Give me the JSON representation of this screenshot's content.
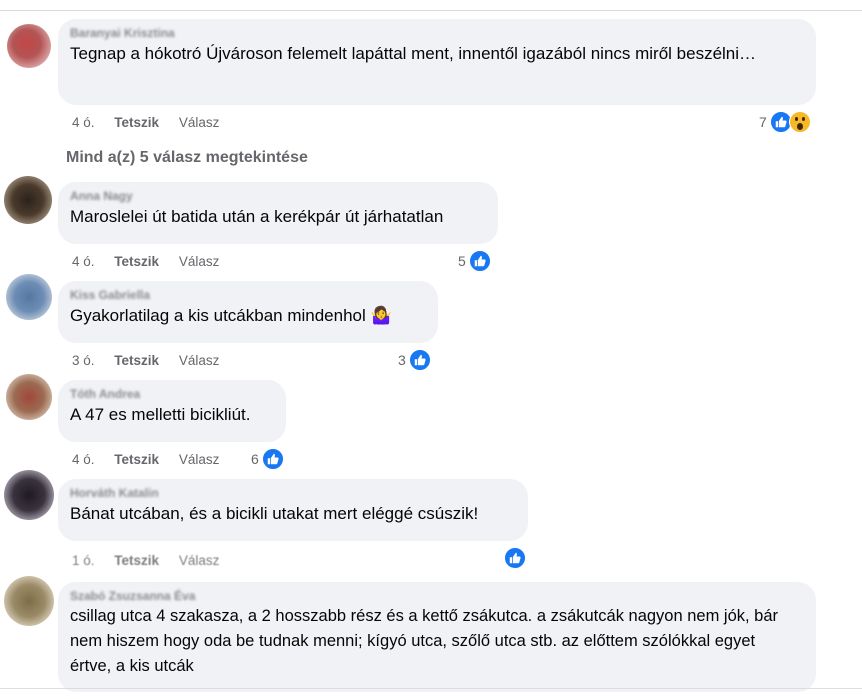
{
  "comments": [
    {
      "author": "Baranyai Krisztina",
      "text": "Tegnap a hókotró Újvároson felemelt lapáttal ment, innentől igazából nincs miről beszélni…",
      "time": "4 ó.",
      "like_label": "Tetszik",
      "reply_label": "Válasz",
      "reaction_count": "7",
      "reactions": [
        "like-icon",
        "wow-icon"
      ],
      "avatar_color": "#b84a4a"
    },
    {
      "author": "Anna Nagy",
      "text": "Maroslelei út batida után a kerékpár út járhatatlan",
      "time": "4 ó.",
      "like_label": "Tetszik",
      "reply_label": "Válasz",
      "reaction_count": "5",
      "reactions": [
        "like-icon"
      ],
      "avatar_color": "#3a2c22"
    },
    {
      "author": "Kiss Gabriella",
      "text": "Gyakorlatilag a kis utcákban mindenhol 🤷‍♀️",
      "time": "3 ó.",
      "like_label": "Tetszik",
      "reply_label": "Válasz",
      "reaction_count": "3",
      "reactions": [
        "like-icon"
      ],
      "avatar_color": "#5a7fa8"
    },
    {
      "author": "Tóth Andrea",
      "text": "A 47 es melletti bicikliút.",
      "time": "4 ó.",
      "like_label": "Tetszik",
      "reply_label": "Válasz",
      "reaction_count": "6",
      "reactions": [
        "like-icon"
      ],
      "avatar_color": "#9a4b3c"
    },
    {
      "author": "Horváth Katalin",
      "text": "Bánat utcában, és a bicikli utakat mert eléggé csúszik!",
      "time": "1 ó.",
      "like_label": "Tetszik",
      "reply_label": "Válasz",
      "reaction_count": "",
      "reactions": [
        "like-icon"
      ],
      "avatar_color": "#2a2430"
    },
    {
      "author": "Szabó Zsuzsanna Éva",
      "text": "csillag utca 4 szakasza, a 2 hosszabb rész és a kettő zsákutca. a zsákutcák nagyon nem jók, bár nem hiszem hogy oda be tudnak menni; kígyó utca, szőlő utca stb. az előttem szólókkal egyet értve, a kis utcák",
      "avatar_color": "#8a7a55"
    }
  ],
  "more_replies_label": "Mind a(z) 5 válasz megtekintése"
}
